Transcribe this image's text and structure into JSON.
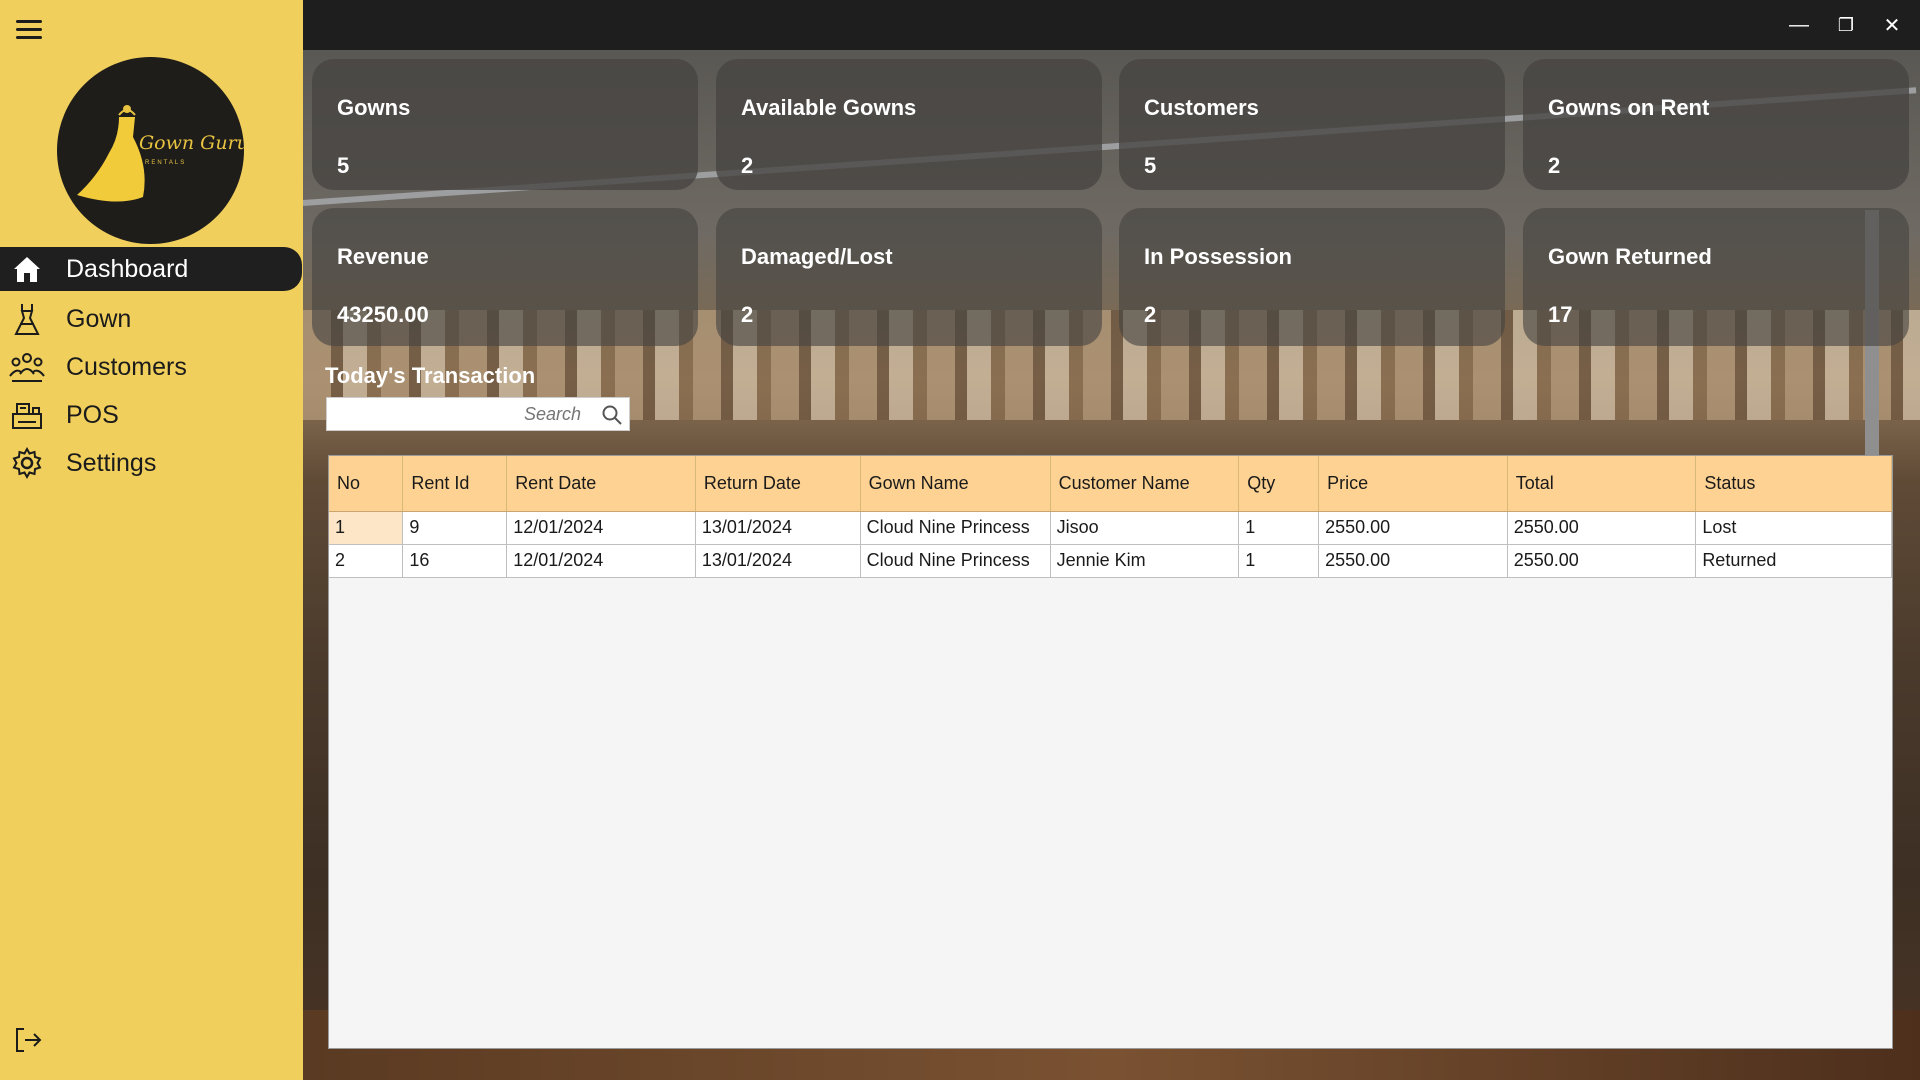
{
  "app": {
    "logo_text": "Gown Guru",
    "logo_subtext": "RENTALS"
  },
  "sidebar": {
    "items": [
      {
        "label": "Dashboard",
        "icon": "home-icon",
        "active": true
      },
      {
        "label": "Gown",
        "icon": "gown-icon",
        "active": false
      },
      {
        "label": "Customers",
        "icon": "customers-icon",
        "active": false
      },
      {
        "label": "POS",
        "icon": "pos-icon",
        "active": false
      },
      {
        "label": "Settings",
        "icon": "gear-icon",
        "active": false
      }
    ],
    "logout_icon": "logout-icon"
  },
  "window": {
    "minimize": "—",
    "restore": "❐",
    "close": "✕"
  },
  "stats": [
    {
      "label": "Gowns",
      "value": "5"
    },
    {
      "label": "Available Gowns",
      "value": "2"
    },
    {
      "label": "Customers",
      "value": "5"
    },
    {
      "label": "Gowns on Rent",
      "value": "2"
    },
    {
      "label": "Revenue",
      "value": "43250.00"
    },
    {
      "label": "Damaged/Lost",
      "value": "2"
    },
    {
      "label": "In Possession",
      "value": "2"
    },
    {
      "label": "Gown Returned",
      "value": "17"
    }
  ],
  "transactions": {
    "title": "Today's Transaction",
    "search_placeholder": "Search",
    "columns": [
      "No",
      "Rent Id",
      "Rent Date",
      "Return Date",
      "Gown Name",
      "Customer Name",
      "Qty",
      "Price",
      "Total",
      "Status"
    ],
    "rows": [
      [
        "1",
        "9",
        "12/01/2024",
        "13/01/2024",
        "Cloud Nine Princess",
        "Jisoo",
        "1",
        "2550.00",
        "2550.00",
        "Lost"
      ],
      [
        "2",
        "16",
        "12/01/2024",
        "13/01/2024",
        "Cloud Nine Princess",
        "Jennie Kim",
        "1",
        "2550.00",
        "2550.00",
        "Returned"
      ]
    ]
  },
  "colors": {
    "sidebar_bg": "#f0cf5c",
    "active_nav_bg": "#1f1f1f",
    "table_header_bg": "#fdd292",
    "titlebar_bg": "#1e1e1e"
  }
}
